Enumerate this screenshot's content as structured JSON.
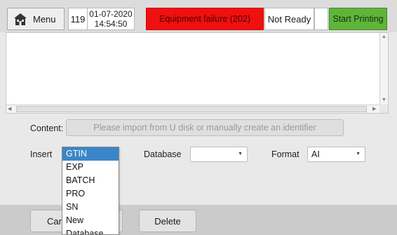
{
  "topbar": {
    "menu_label": "Menu",
    "counter": "119",
    "date": "01-07-2020",
    "time": "14:54:50",
    "alarm": "Equipment failure (202)",
    "status": "Not Ready",
    "start_label": "Start Printing"
  },
  "form": {
    "content_label": "Content:",
    "content_placeholder": "Please import from U disk or manually create an identifier",
    "insert_label": "Insert",
    "database_label": "Database",
    "database_value": "",
    "format_label": "Format",
    "format_value": "AI"
  },
  "insert_dropdown": {
    "items": [
      "GTIN",
      "EXP",
      "BATCH",
      "PRO",
      "SN",
      "New",
      "Database"
    ],
    "selected": "GTIN"
  },
  "buttons": {
    "cancel_label": "Can",
    "delete_label": "Delete"
  },
  "colors": {
    "alarm": "#ef1010",
    "start": "#5fb53b",
    "selected": "#3a86c8"
  }
}
